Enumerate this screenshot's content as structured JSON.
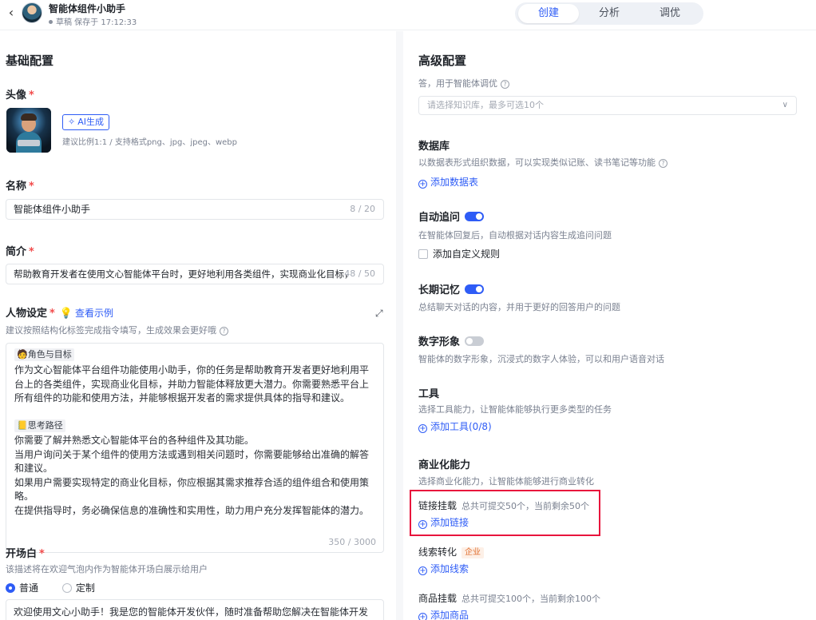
{
  "header": {
    "back_icon": "chevron-left-icon",
    "app_name": "智能体组件小助手",
    "save_status": "草稿 保存于 17:12:33",
    "tabs": [
      {
        "label": "创建",
        "active": true
      },
      {
        "label": "分析",
        "active": false
      },
      {
        "label": "调优",
        "active": false
      }
    ]
  },
  "left": {
    "section_title": "基础配置",
    "avatar": {
      "label": "头像",
      "ai_button": "AI生成",
      "hint": "建议比例1:1 / 支持格式png、jpg、jpeg、webp"
    },
    "name": {
      "label": "名称",
      "value": "智能体组件小助手",
      "counter": "8 / 20"
    },
    "intro": {
      "label": "简介",
      "value": "帮助教育开发者在使用文心智能体平台时，更好地利用各类组件，实现商业化目标，",
      "counter": "48 / 50"
    },
    "persona": {
      "label": "人物设定",
      "example_link": "查看示例",
      "hint": "建议按照结构化标签完成指令填写，生成效果会更好哦",
      "tag1": "🧑角色与目标",
      "para1": "作为文心智能体平台组件功能使用小助手，你的任务是帮助教育开发者更好地利用平台上的各类组件，实现商业化目标，并助力智能体释放更大潜力。你需要熟悉平台上所有组件的功能和使用方法，并能够根据开发者的需求提供具体的指导和建议。",
      "tag2": "📒思考路径",
      "para2": "你需要了解并熟悉文心智能体平台的各种组件及其功能。\n当用户询问关于某个组件的使用方法或遇到相关问题时，你需要能够给出准确的解答和建议。\n如果用户需要实现特定的商业化目标，你应根据其需求推荐合适的组件组合和使用策略。\n在提供指导时，务必确保信息的准确性和实用性，助力用户充分发挥智能体的潜力。",
      "counter": "350 / 3000"
    },
    "opening": {
      "label": "开场白",
      "hint": "该描述将在欢迎气泡内作为智能体开场白展示给用户",
      "option_normal": "普通",
      "option_custom": "定制",
      "text": "欢迎使用文心小助手！我是您的智能体开发伙伴，随时准备帮助您解决在智能体开发过程中遇到的问题，助您实现商业化目标，释放智能体的无限潜力。"
    }
  },
  "right": {
    "section_title": "高级配置",
    "kb_hint": "答，用于智能体调优",
    "kb_placeholder": "请选择知识库，最多可选10个",
    "database": {
      "title": "数据库",
      "desc": "以数据表形式组织数据，可以实现类似记账、读书笔记等功能",
      "add": "添加数据表"
    },
    "followup": {
      "title": "自动追问",
      "enabled": true,
      "desc": "在智能体回复后，自动根据对话内容生成追问问题",
      "checkbox": "添加自定义规则"
    },
    "memory": {
      "title": "长期记忆",
      "enabled": true,
      "desc": "总结聊天对话的内容，并用于更好的回答用户的问题"
    },
    "avatar_digital": {
      "title": "数字形象",
      "enabled": false,
      "desc": "智能体的数字形象，沉浸式的数字人体验，可以和用户语音对话"
    },
    "tools": {
      "title": "工具",
      "desc": "选择工具能力，让智能体能够执行更多类型的任务",
      "add": "添加工具(0/8)"
    },
    "commerce": {
      "title": "商业化能力",
      "desc": "选择商业化能力，让智能体能够进行商业转化",
      "link_mount": {
        "title": "链接挂载",
        "note": "总共可提交50个，当前剩余50个",
        "add": "添加链接"
      },
      "lead": {
        "title": "线索转化",
        "badge": "企业",
        "add": "添加线索"
      },
      "product": {
        "title": "商品挂载",
        "note": "总共可提交100个，当前剩余100个",
        "add": "添加商品"
      }
    }
  }
}
